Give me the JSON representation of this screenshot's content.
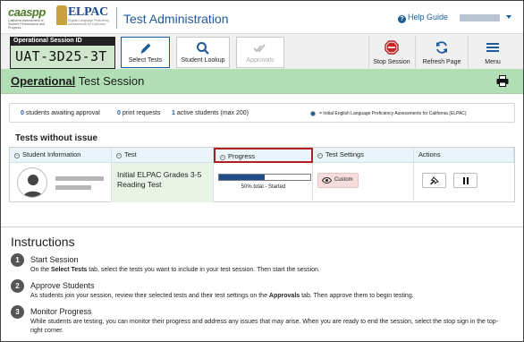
{
  "header": {
    "caaspp_logo": "caaspp",
    "caaspp_sub": "California Assessment of Student Performance and Progress",
    "elpac_logo": "ELPAC",
    "elpac_sub": "English Language Proficiency Assessments for California",
    "app_title": "Test Administration",
    "help_label": "Help Guide"
  },
  "session": {
    "id_label": "Operational Session ID",
    "id": "UAT-3D25-3T"
  },
  "toolbar": {
    "select_tests": "Select Tests",
    "student_lookup": "Student Lookup",
    "approvals": "Approvals",
    "stop_session": "Stop Session",
    "refresh_page": "Refresh Page",
    "menu": "Menu"
  },
  "session_bar": {
    "title_bold": "Operational",
    "title_rest": "Test Session"
  },
  "stats": {
    "awaiting_count": "0",
    "awaiting_label": "students awaiting approval",
    "print_count": "0",
    "print_label": "print requests",
    "active_count": "1",
    "active_label": "active students (max 200)",
    "legend": "= Initial English Language Proficiency Assessments for California (ELPAC)"
  },
  "tests_section": {
    "heading": "Tests without issue",
    "columns": [
      "Student Information",
      "Test",
      "Progress",
      "Test Settings",
      "Actions"
    ],
    "rows": [
      {
        "test": "Initial ELPAC Grades 3-5 Reading Test",
        "progress_fraction": 0.5,
        "progress_text": "50% total  -  Started",
        "settings": "Custom"
      }
    ]
  },
  "instructions": {
    "heading": "Instructions",
    "steps": [
      {
        "num": "1",
        "title": "Start Session",
        "pre": "On the ",
        "bold": "Select Tests",
        "post": " tab, select the tests you want to include in your test session. Then start the session."
      },
      {
        "num": "2",
        "title": "Approve Students",
        "pre": "As students join your session, review their selected tests and their test settings on the ",
        "bold": "Approvals",
        "post": " tab. Then approve them to begin testing."
      },
      {
        "num": "3",
        "title": "Monitor Progress",
        "pre": "While students are testing, you can monitor their progress and address any issues that may arise. When you are ready to end the session, select the stop sign in the top-right corner.",
        "bold": "",
        "post": ""
      }
    ]
  },
  "colors": {
    "brand_blue": "#1e5a9a",
    "session_green": "#b2deb5",
    "highlight_red": "#b21e22"
  }
}
